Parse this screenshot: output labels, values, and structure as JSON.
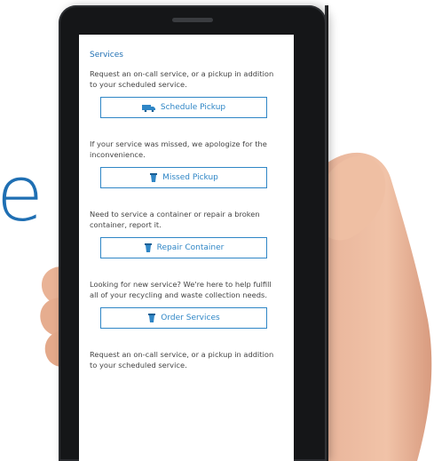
{
  "background_text": "e",
  "screen": {
    "heading": "Services",
    "blocks": [
      {
        "description": "Request an on-call service, or a pickup in addition to your scheduled service.",
        "button_label": "Schedule Pickup",
        "icon": "truck-icon"
      },
      {
        "description": "If your service was missed, we apologize for the inconvenience.",
        "button_label": "Missed Pickup",
        "icon": "bin-icon"
      },
      {
        "description": "Need to service a container or repair a broken container, report it.",
        "button_label": "Repair Container",
        "icon": "bin-icon"
      },
      {
        "description": "Looking for new service? We're here to help fulfill all of your recycling and waste collection needs.",
        "button_label": "Order Services",
        "icon": "bin-icon"
      }
    ],
    "footer_description": "Request an on-call service, or a pickup in addition to your scheduled service."
  },
  "colors": {
    "accent": "#2f86c6",
    "background_text": "#1f6fb3",
    "phone_body": "#151618"
  }
}
